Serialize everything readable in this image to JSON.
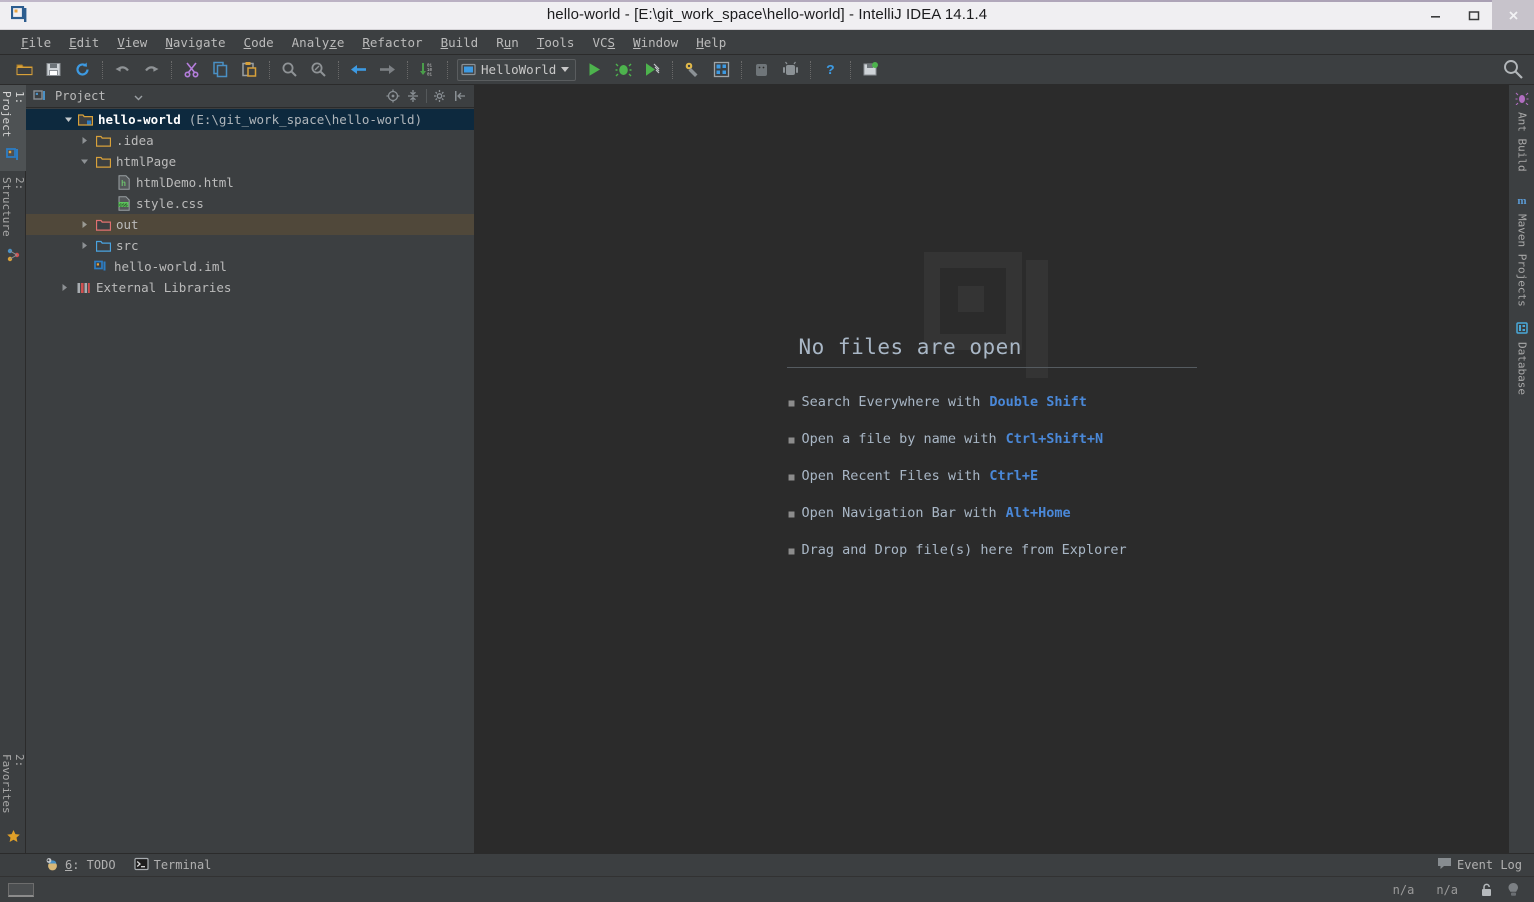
{
  "window": {
    "title": "hello-world - [E:\\git_work_space\\hello-world] - IntelliJ IDEA 14.1.4",
    "logo_icon": "intellij-idea-logo",
    "controls": {
      "minimize_label": "–",
      "minimize_icon": "minimize-icon",
      "maximize_icon": "maximize-icon",
      "close_label": "✕",
      "close_icon": "close-icon"
    }
  },
  "menubar": {
    "items": [
      {
        "label": "File",
        "mnemonic": "F"
      },
      {
        "label": "Edit",
        "mnemonic": "E"
      },
      {
        "label": "View",
        "mnemonic": "V"
      },
      {
        "label": "Navigate",
        "mnemonic": "N"
      },
      {
        "label": "Code",
        "mnemonic": "C"
      },
      {
        "label": "Analyze",
        "mnemonic": "z"
      },
      {
        "label": "Refactor",
        "mnemonic": "R"
      },
      {
        "label": "Build",
        "mnemonic": "B"
      },
      {
        "label": "Run",
        "mnemonic": "u"
      },
      {
        "label": "Tools",
        "mnemonic": "T"
      },
      {
        "label": "VCS",
        "mnemonic": "S"
      },
      {
        "label": "Window",
        "mnemonic": "W"
      },
      {
        "label": "Help",
        "mnemonic": "H"
      }
    ]
  },
  "toolbar": {
    "icons": [
      "open-folder-icon",
      "save-all-icon",
      "synchronize-icon",
      "undo-icon",
      "redo-icon",
      "cut-icon",
      "copy-icon",
      "paste-icon",
      "find-icon",
      "replace-icon",
      "back-icon",
      "forward-icon",
      "compile-icon"
    ],
    "run_configuration": {
      "name": "HelloWorld",
      "icon": "run-config-icon",
      "dropdown_icon": "chevron-down-icon"
    },
    "run_icon": "run-icon",
    "debug_icon": "debug-icon",
    "run_coverage_icon": "run-with-coverage-icon",
    "settings_icon": "project-structure-icon",
    "project_structure_icon": "project-settings-icon",
    "android_avd_icon": "avd-manager-icon",
    "android_sdk_icon": "sdk-manager-icon",
    "help_icon": "help-icon",
    "save_icon": "save-icon",
    "search_icon": "search-everywhere-icon"
  },
  "left_stripe": {
    "top_items": [
      {
        "label": "1: Project",
        "icon": "project-icon",
        "selected": true
      },
      {
        "label": "2: Structure",
        "icon": "structure-icon",
        "selected": false
      }
    ],
    "bottom_items": [
      {
        "label": "2: Favorites",
        "icon": "favorites-star-icon",
        "selected": false
      }
    ]
  },
  "right_stripe": {
    "items": [
      {
        "label": "Ant Build",
        "icon": "ant-icon"
      },
      {
        "label": "Maven Projects",
        "icon": "maven-icon"
      },
      {
        "label": "Database",
        "icon": "database-icon"
      }
    ]
  },
  "project_panel": {
    "title": "Project",
    "title_icon": "project-view-icon",
    "dropdown_icon": "chevron-down-icon",
    "actions": [
      {
        "name": "scroll-from-source-icon"
      },
      {
        "name": "collapse-all-icon"
      },
      {
        "name": "settings-gear-icon"
      },
      {
        "name": "hide-panel-icon"
      }
    ],
    "tree": [
      {
        "label": "hello-world",
        "suffix": "(E:\\git_work_space\\hello-world)",
        "icon": "module-folder-icon",
        "twisty": "down",
        "indent": 0,
        "state": "selected"
      },
      {
        "label": ".idea",
        "suffix": "",
        "icon": "folder-icon",
        "twisty": "right",
        "indent": 1,
        "state": "normal"
      },
      {
        "label": "htmlPage",
        "suffix": "",
        "icon": "folder-icon",
        "twisty": "down",
        "indent": 1,
        "state": "normal"
      },
      {
        "label": "htmlDemo.html",
        "suffix": "",
        "icon": "html-file-icon",
        "twisty": "none",
        "indent": 2,
        "state": "normal"
      },
      {
        "label": "style.css",
        "suffix": "",
        "icon": "css-file-icon",
        "twisty": "none",
        "indent": 2,
        "state": "normal"
      },
      {
        "label": "out",
        "suffix": "",
        "icon": "excluded-folder-icon",
        "twisty": "right",
        "indent": 1,
        "state": "highlight"
      },
      {
        "label": "src",
        "suffix": "",
        "icon": "source-folder-icon",
        "twisty": "right",
        "indent": 1,
        "state": "normal"
      },
      {
        "label": "hello-world.iml",
        "suffix": "",
        "icon": "iml-file-icon",
        "twisty": "none",
        "indent": 1,
        "state": "normal"
      },
      {
        "label": "External Libraries",
        "suffix": "",
        "icon": "libraries-icon",
        "twisty": "right",
        "indent": 0,
        "state": "normal"
      }
    ]
  },
  "editor": {
    "watermark_icon": "intellij-idea-watermark",
    "heading": "No files are open",
    "tips": [
      {
        "text": "Search Everywhere with",
        "key": "Double Shift"
      },
      {
        "text": "Open a file by name with",
        "key": "Ctrl+Shift+N"
      },
      {
        "text": "Open Recent Files with",
        "key": "Ctrl+E"
      },
      {
        "text": "Open Navigation Bar with",
        "key": "Alt+Home"
      },
      {
        "text": "Drag and Drop file(s) here from Explorer",
        "key": ""
      }
    ]
  },
  "bottom_bar": {
    "items": [
      {
        "label": "6: TODO",
        "mnemonic": "6",
        "icon": "todo-icon"
      },
      {
        "label": "Terminal",
        "mnemonic": "",
        "icon": "terminal-icon"
      }
    ],
    "event_log": {
      "label": "Event Log",
      "icon": "event-log-icon"
    }
  },
  "status_bar": {
    "memory_indicator_icon": "memory-indicator-icon",
    "position": "n/a",
    "encoding": "n/a",
    "lock_icon": "read-only-lock-icon",
    "inspection_icon": "inspection-icon"
  },
  "colors": {
    "titlebar_bg": "#f0eff2",
    "chrome_bg": "#3c3f41",
    "editor_bg": "#2b2b2b",
    "text": "#bbbbbb",
    "editor_text": "#a9b7c6",
    "key_accent": "#4a88d8",
    "selection": "#0d293e",
    "highlight_row": "#50483a"
  }
}
